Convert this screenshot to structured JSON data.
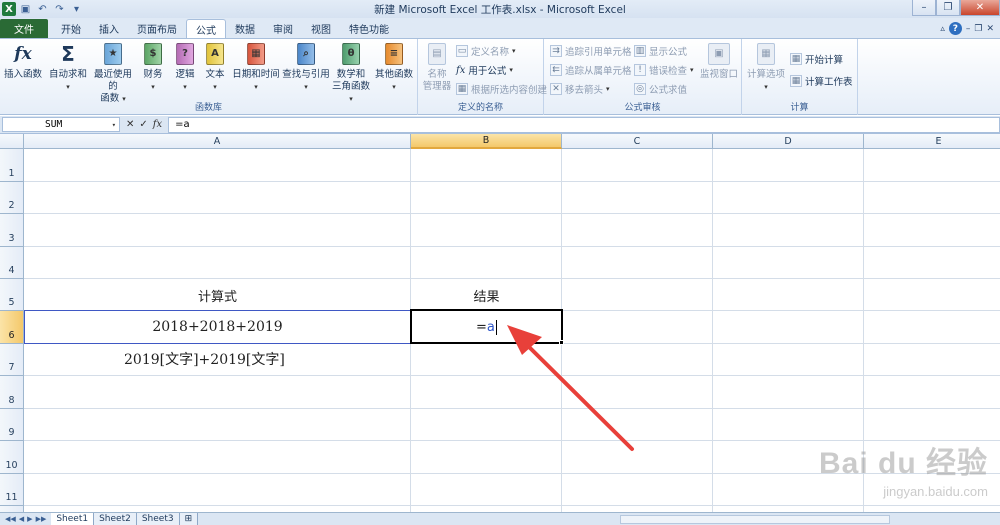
{
  "window": {
    "title": "新建 Microsoft Excel 工作表.xlsx - Microsoft Excel"
  },
  "tabs": [
    {
      "label": "文件"
    },
    {
      "label": "开始"
    },
    {
      "label": "插入"
    },
    {
      "label": "页面布局"
    },
    {
      "label": "公式"
    },
    {
      "label": "数据"
    },
    {
      "label": "审阅"
    },
    {
      "label": "视图"
    },
    {
      "label": "特色功能"
    }
  ],
  "ribbon": {
    "library": {
      "group_label": "函数库",
      "insert_function": "插入函数",
      "autosum": "自动求和",
      "recent_line1": "最近使用的",
      "recent_line2": "函数",
      "financial": "财务",
      "logical": "逻辑",
      "text": "文本",
      "datetime": "日期和时间",
      "lookup": "查找与引用",
      "math_line1": "数学和",
      "math_line2": "三角函数",
      "more": "其他函数"
    },
    "names": {
      "group_label": "定义的名称",
      "name_manager_line1": "名称",
      "name_manager_line2": "管理器",
      "define_name": "定义名称",
      "use_in_formula": "用于公式",
      "create_from_selection": "根据所选内容创建"
    },
    "audit": {
      "group_label": "公式审核",
      "trace_precedents": "追踪引用单元格",
      "trace_dependents": "追踪从属单元格",
      "remove_arrows": "移去箭头",
      "show_formulas": "显示公式",
      "error_check": "错误检查",
      "evaluate": "公式求值",
      "watch_window": "监视窗口"
    },
    "calc": {
      "group_label": "计算",
      "options": "计算选项",
      "calc_now": "开始计算",
      "calc_sheet": "计算工作表"
    }
  },
  "formula_bar": {
    "name_box": "SUM",
    "fx": "fx",
    "value": "=a"
  },
  "grid": {
    "columns": [
      "A",
      "B",
      "C",
      "D",
      "E"
    ],
    "rows": [
      "1",
      "2",
      "3",
      "4",
      "5",
      "6",
      "7",
      "8",
      "9",
      "10",
      "11"
    ],
    "cells": {
      "a5": "计算式",
      "b5": "结果",
      "a6": "2018+2018+2019",
      "a7": "2019[文字]+2019[文字]",
      "b6_eq": "=",
      "b6_ref": "a"
    }
  },
  "sheets": [
    "Sheet1",
    "Sheet2",
    "Sheet3"
  ],
  "watermark": {
    "logo": "Bai du 经验",
    "sub": "jingyan.baidu.com"
  },
  "colors": {
    "accent": "#2a6a35",
    "selection": "#f4c86a",
    "reference_blue": "#2d55c8",
    "arrow_red": "#e8403a"
  }
}
